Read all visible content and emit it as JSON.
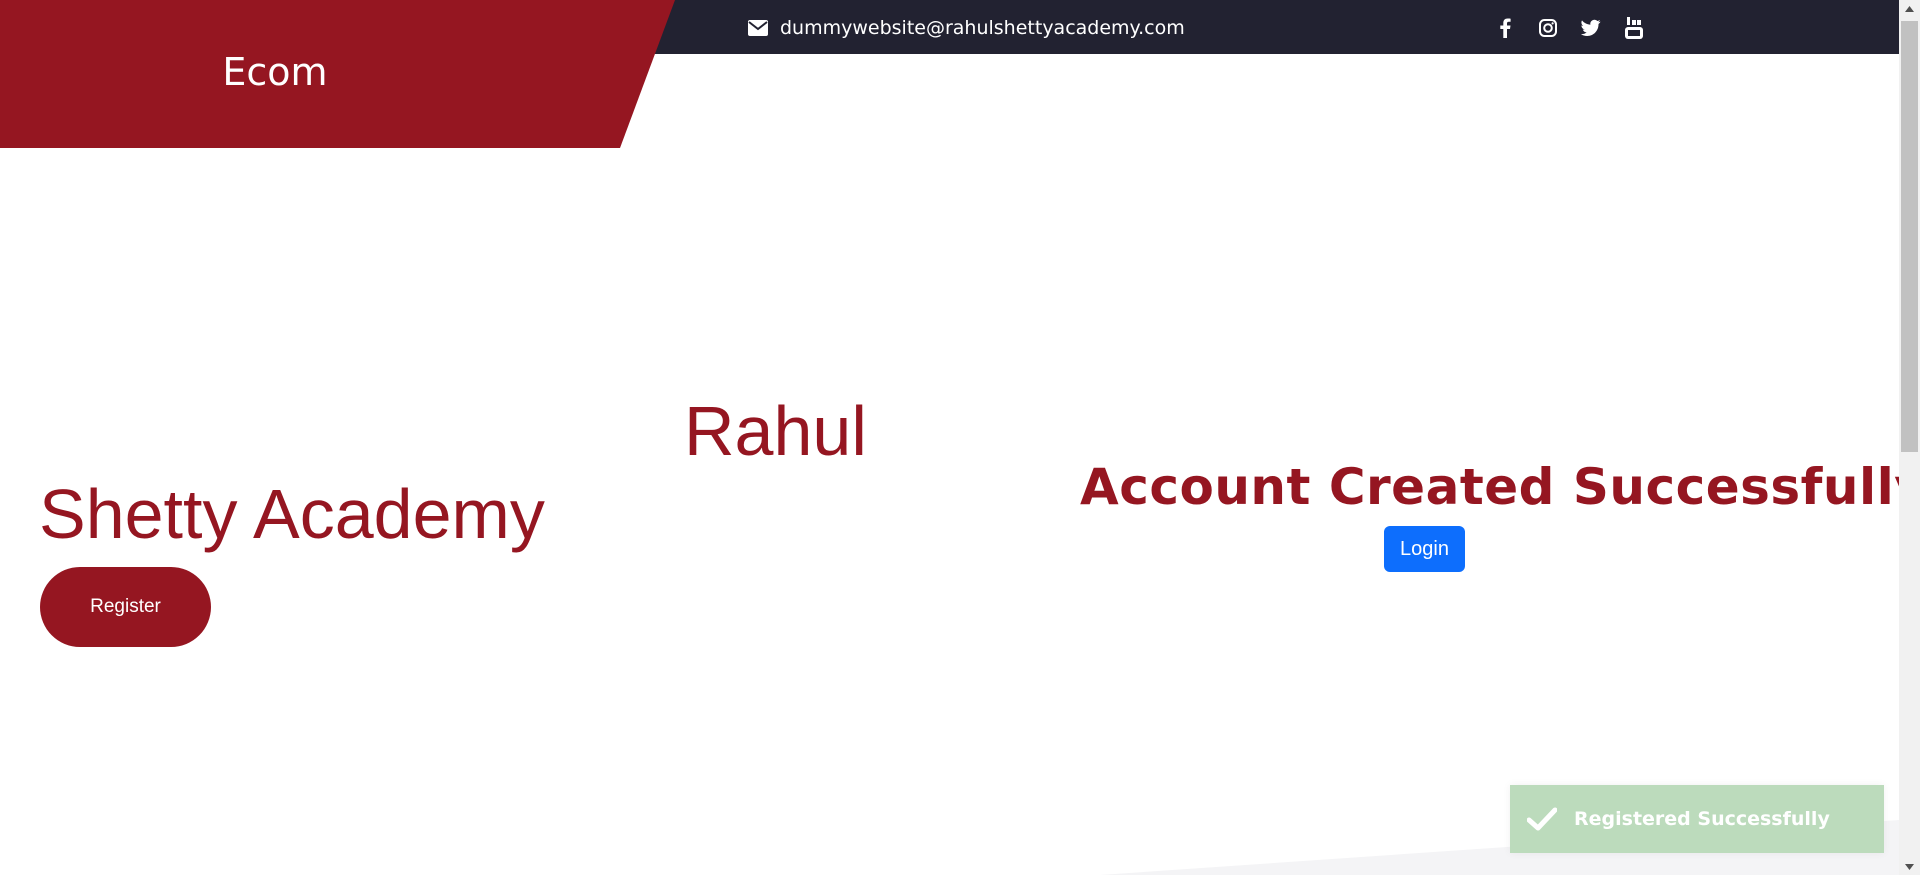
{
  "header": {
    "brand": "Ecom",
    "email": "dummywebsite@rahulshettyacademy.com",
    "socials": [
      "facebook",
      "instagram",
      "twitter",
      "youtube"
    ]
  },
  "hero": {
    "line1": "Rahul",
    "line2": "Shetty Academy",
    "register_label": "Register"
  },
  "confirmation": {
    "title": "Account Created Successfully",
    "login_label": "Login"
  },
  "toast": {
    "message": "Registered Successfully",
    "icon": "check-icon"
  },
  "colors": {
    "brand": "#951621",
    "topbar": "#222231",
    "primary": "#0d6efd",
    "toast_bg": "#bcdbbc"
  }
}
